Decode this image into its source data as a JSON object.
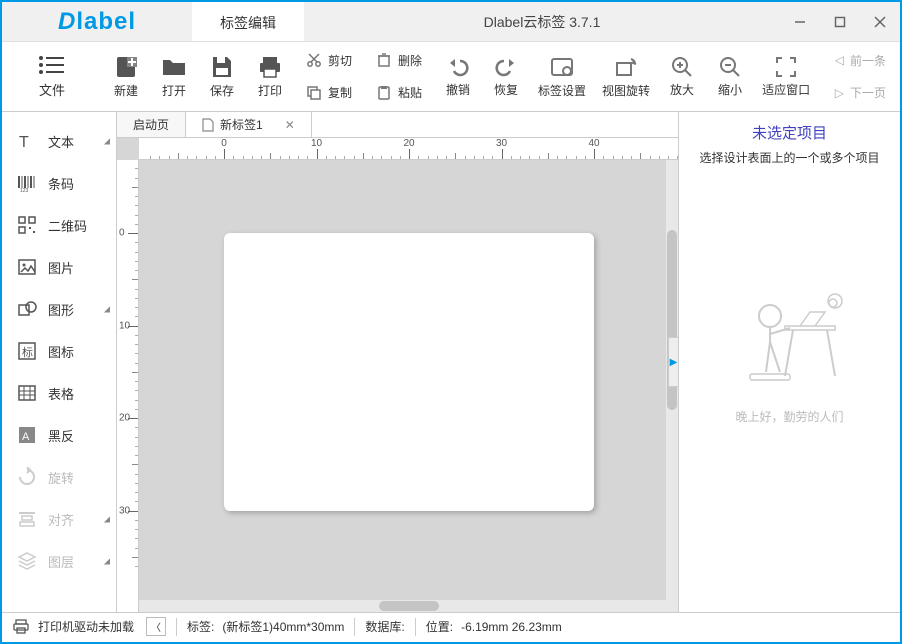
{
  "app": {
    "logo_text": "label",
    "tab": "标签编辑",
    "title": "Dlabel云标签 3.7.1"
  },
  "toolbar": {
    "file": "文件",
    "new": "新建",
    "open": "打开",
    "save": "保存",
    "print": "打印",
    "cut": "剪切",
    "copy": "复制",
    "delete": "删除",
    "paste": "粘贴",
    "undo": "撤销",
    "redo": "恢复",
    "labelset": "标签设置",
    "viewrotate": "视图旋转",
    "zoomin": "放大",
    "zoomout": "缩小",
    "fit": "适应窗口",
    "prevpage": "前一条",
    "nextpage": "下一页"
  },
  "side": {
    "text": "文本",
    "barcode": "条码",
    "qrcode": "二维码",
    "image": "图片",
    "shape": "图形",
    "icon": "图标",
    "table": "表格",
    "invert": "黑反",
    "rotate": "旋转",
    "align": "对齐",
    "layer": "图层"
  },
  "doctabs": {
    "start": "启动页",
    "new": "新标签1"
  },
  "ruler": {
    "h": [
      "0",
      "10",
      "20",
      "30",
      "40"
    ],
    "v": [
      "0",
      "10",
      "20",
      "30"
    ]
  },
  "right": {
    "title": "未选定项目",
    "subtitle": "选择设计表面上的一个或多个项目",
    "caption": "晚上好，勤劳的人们"
  },
  "status": {
    "printer": "打印机驱动未加载",
    "label_prefix": "标签: ",
    "label_value": "(新标签1)40mm*30mm",
    "db_prefix": "数据库: ",
    "pos_prefix": "位置: ",
    "pos_value": "-6.19mm 26.23mm"
  }
}
